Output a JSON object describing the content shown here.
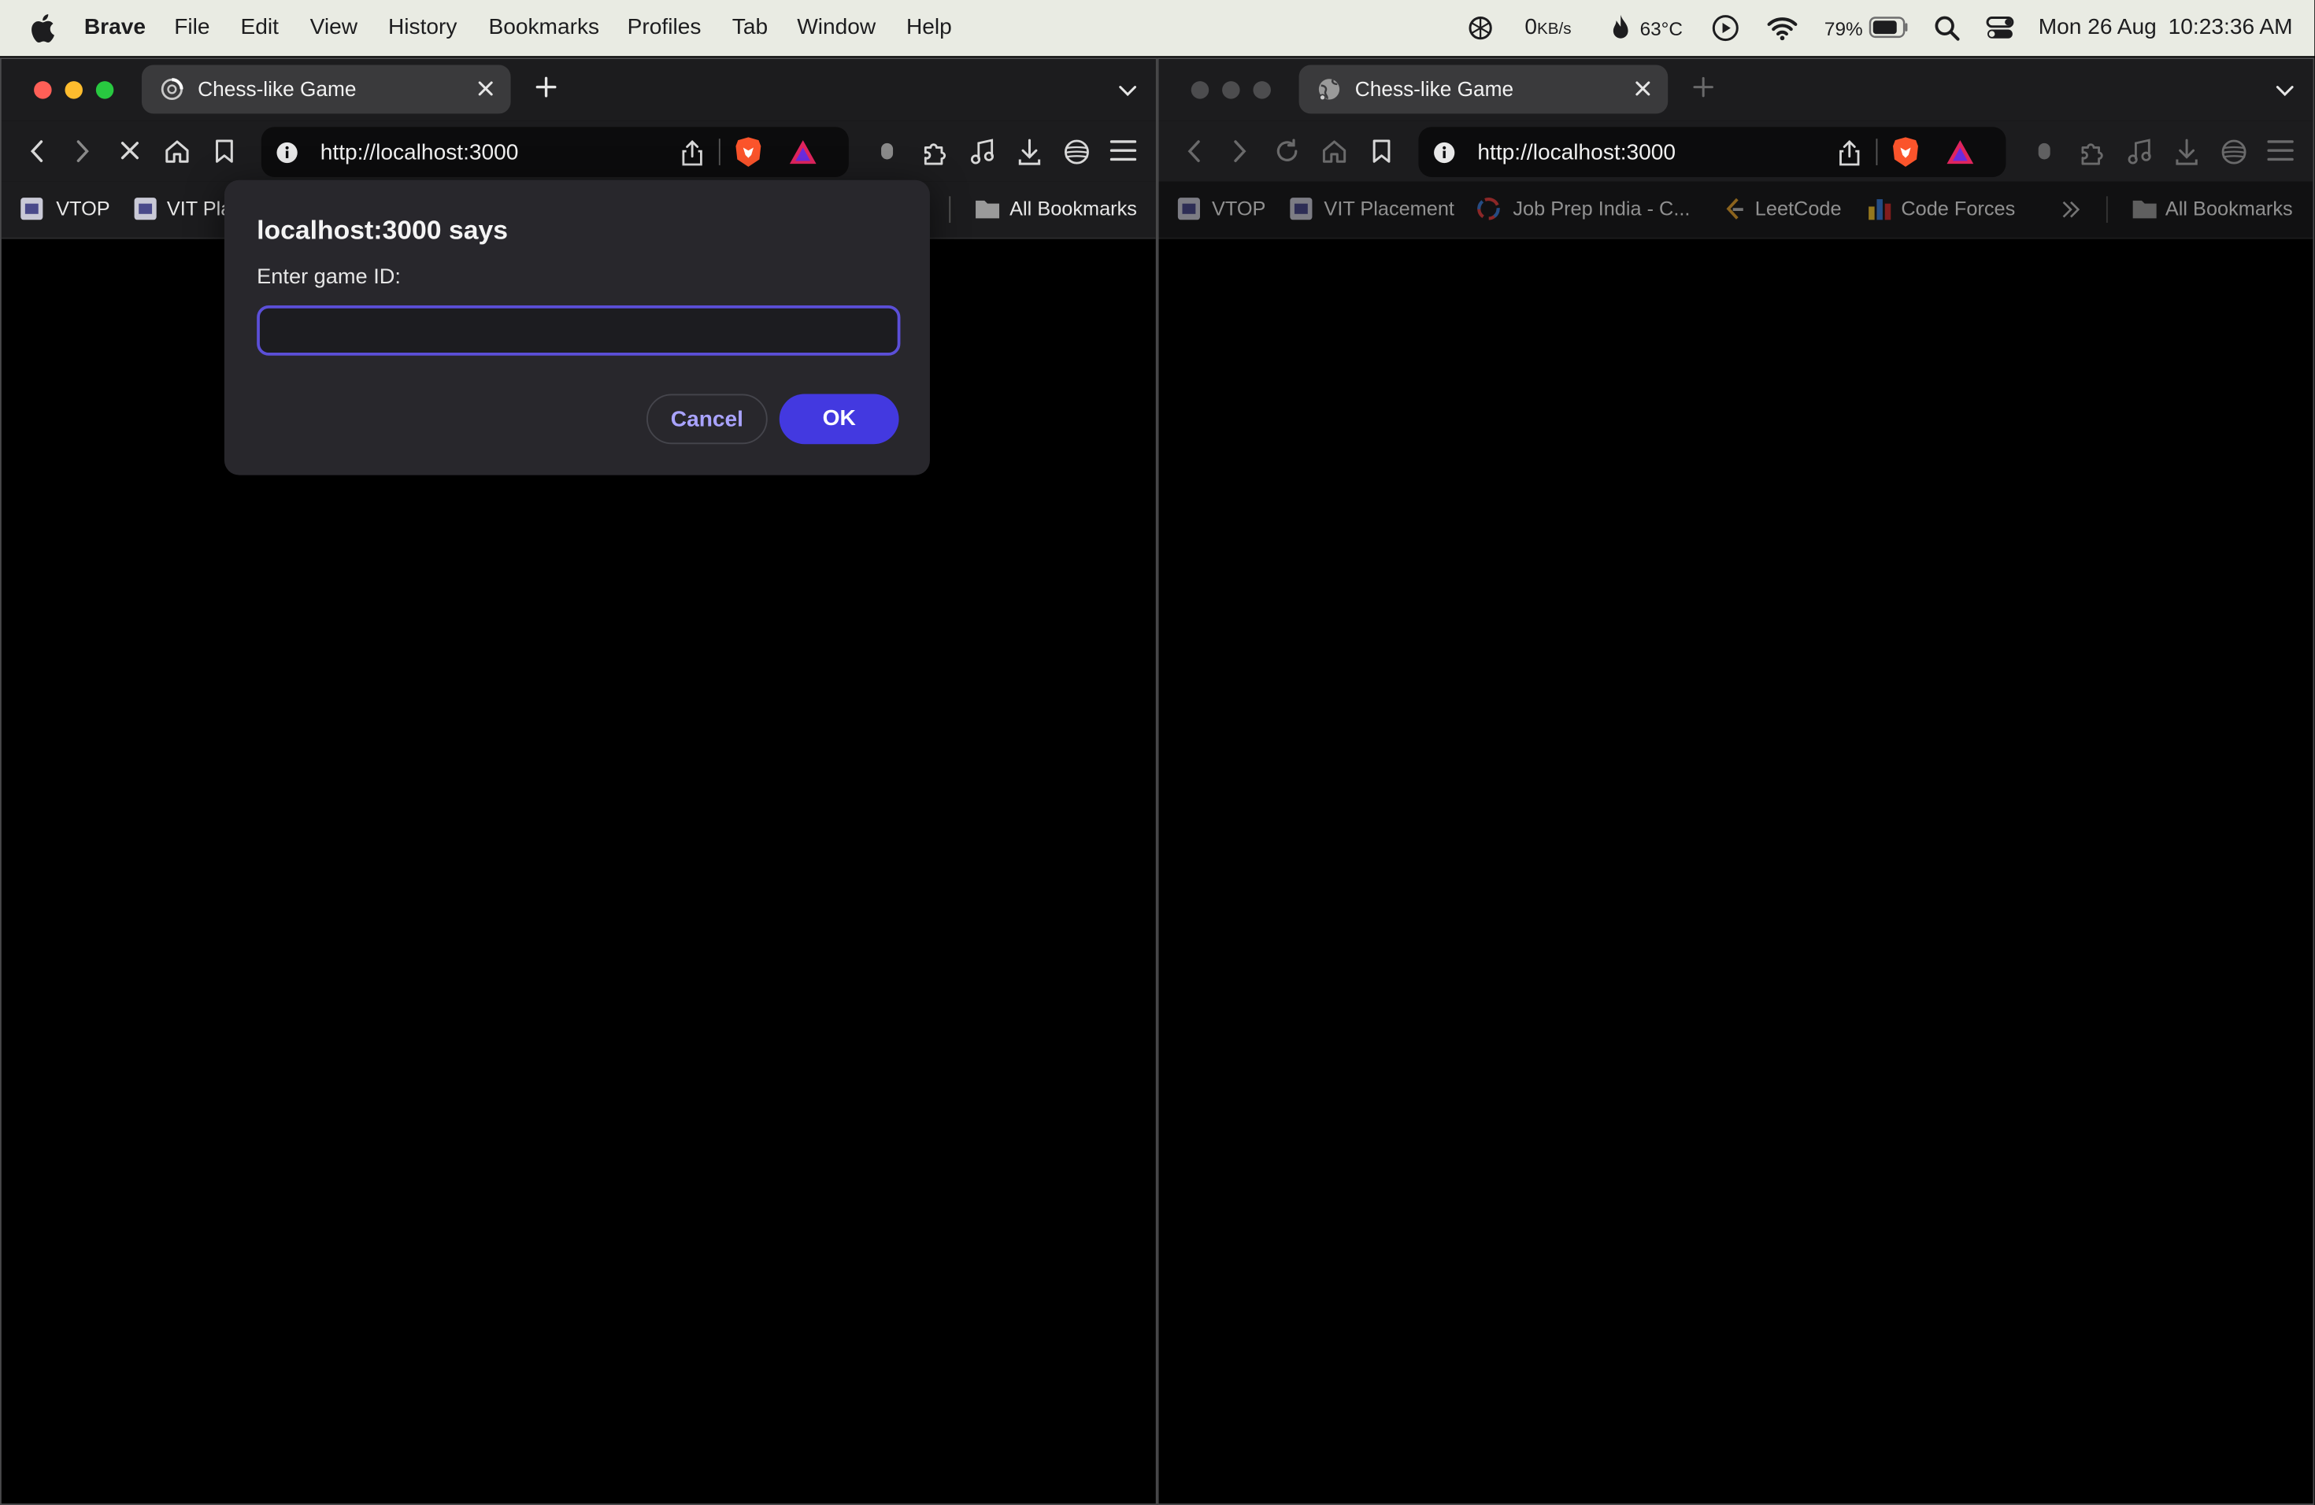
{
  "menubar": {
    "app_name": "Brave",
    "menus": [
      "File",
      "Edit",
      "View",
      "History",
      "Bookmarks",
      "Profiles",
      "Tab",
      "Window",
      "Help"
    ],
    "status": {
      "network_value": "0",
      "network_unit": "KB/s",
      "temperature": "63°C",
      "battery_percent": "79%",
      "date": "Mon 26 Aug",
      "time": "10:23:36 AM"
    }
  },
  "windows": [
    {
      "tab_title": "Chess-like Game",
      "url": "http://localhost:3000",
      "bookmarks": [
        "VTOP",
        "VIT Pla"
      ],
      "all_bookmarks_label": "All Bookmarks",
      "active": true,
      "loading": true
    },
    {
      "tab_title": "Chess-like Game",
      "url": "http://localhost:3000",
      "bookmarks": [
        "VTOP",
        "VIT Placement",
        "Job Prep India - C...",
        "LeetCode",
        "Code Forces"
      ],
      "all_bookmarks_label": "All Bookmarks",
      "active": false,
      "loading": false
    }
  ],
  "dialog": {
    "title": "localhost:3000 says",
    "message": "Enter game ID:",
    "input_value": "",
    "cancel_label": "Cancel",
    "ok_label": "OK"
  },
  "colors": {
    "accent": "#4339e0",
    "focus_ring": "#5b4fd8",
    "menubar_bg": "#e9ebe3",
    "chrome_bg": "#1c1c1e",
    "close_light": "#ff5f57",
    "minimize_light": "#febc2e",
    "zoom_light": "#28c840"
  },
  "icons": [
    "apple-icon",
    "chatgpt-icon",
    "flame-icon",
    "play-icon",
    "wifi-icon",
    "battery-icon",
    "search-icon",
    "control-center-icon",
    "back-icon",
    "forward-icon",
    "stop-icon",
    "reload-icon",
    "home-icon",
    "bookmark-icon",
    "info-icon",
    "share-icon",
    "brave-shields-icon",
    "brave-rewards-icon",
    "extensions-icon",
    "music-icon",
    "download-icon",
    "wallet-icon",
    "menu-icon",
    "folder-icon"
  ]
}
